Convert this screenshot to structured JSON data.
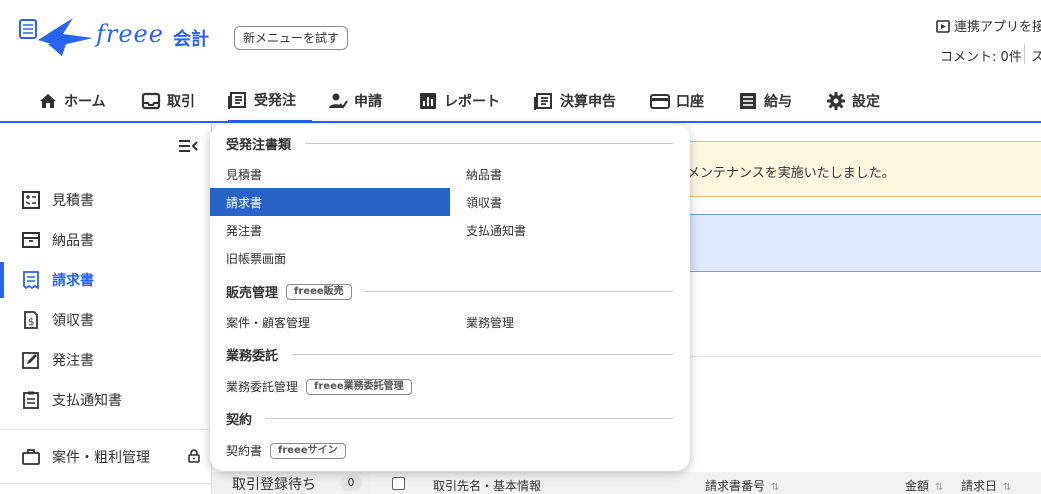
{
  "header": {
    "logo_text": "freee",
    "logo_product": "会計",
    "try_new_menu": "新メニューを試す",
    "renkei_label": "連携アプリを接",
    "comment_label": "コメント: 0件",
    "comment_extra": "ス"
  },
  "nav": {
    "items": [
      {
        "label": "ホーム",
        "icon": "home-icon"
      },
      {
        "label": "取引",
        "icon": "inbox-icon"
      },
      {
        "label": "受発注",
        "icon": "document-icon"
      },
      {
        "label": "申請",
        "icon": "approval-icon"
      },
      {
        "label": "レポート",
        "icon": "chart-icon"
      },
      {
        "label": "決算申告",
        "icon": "document-icon"
      },
      {
        "label": "口座",
        "icon": "card-icon"
      },
      {
        "label": "給与",
        "icon": "payroll-icon"
      },
      {
        "label": "設定",
        "icon": "gear-icon"
      }
    ],
    "active": "受発注"
  },
  "sidebar": {
    "items": [
      {
        "label": "見積書"
      },
      {
        "label": "納品書"
      },
      {
        "label": "請求書"
      },
      {
        "label": "領収書"
      },
      {
        "label": "発注書"
      },
      {
        "label": "支払通知書"
      },
      {
        "label": "案件・粗利管理"
      }
    ],
    "active": "請求書"
  },
  "main": {
    "notice_yellow": "メンテナンスを実施いたしました。",
    "pending_label": "取引登録待ち",
    "pending_count": "0",
    "table_headers": {
      "partner": "取引先名・基本情報",
      "invoice_no": "請求書番号",
      "amount": "金額",
      "invoice_date": "請求日"
    }
  },
  "dropdown": {
    "section1": "受発注書類",
    "col1": [
      "見積書",
      "請求書",
      "発注書",
      "旧帳票画面"
    ],
    "col2": [
      "納品書",
      "領収書",
      "支払通知書"
    ],
    "highlighted": "請求書",
    "section2": "販売管理",
    "section2_tag": "freee販売",
    "section2_items": [
      "案件・顧客管理",
      "業務管理"
    ],
    "section3": "業務委託",
    "section3_item": "業務委託管理",
    "section3_tag": "freee業務委託管理",
    "section4": "契約",
    "section4_item": "契約書",
    "section4_tag": "freeeサイン"
  },
  "colors": {
    "brand": "#2864f0",
    "highlight": "#2864c8",
    "notice_yellow_bg": "#fff8e1",
    "notice_blue_bg": "#dfe8fc"
  }
}
